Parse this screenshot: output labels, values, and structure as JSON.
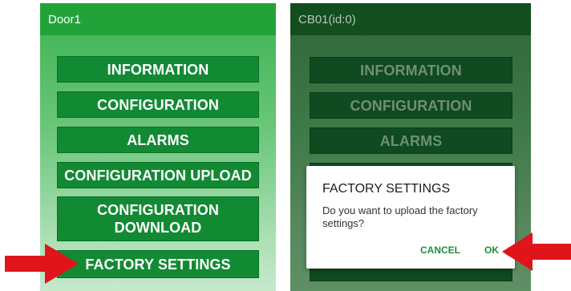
{
  "left_screen": {
    "title": "Door1",
    "menu": [
      "INFORMATION",
      "CONFIGURATION",
      "ALARMS",
      "CONFIGURATION UPLOAD",
      "CONFIGURATION DOWNLOAD",
      "FACTORY SETTINGS"
    ]
  },
  "right_screen": {
    "title": "CB01(id:0)",
    "menu": [
      "INFORMATION",
      "CONFIGURATION",
      "ALARMS"
    ],
    "dialog": {
      "title": "FACTORY SETTINGS",
      "message": "Do you want to upload the factory settings?",
      "cancel_label": "CANCEL",
      "ok_label": "OK"
    }
  },
  "colors": {
    "arrow": "#e0141b",
    "accent_green": "#128a34",
    "dialog_action": "#1f8f3a"
  },
  "icons": [
    "red-arrow-icon"
  ]
}
